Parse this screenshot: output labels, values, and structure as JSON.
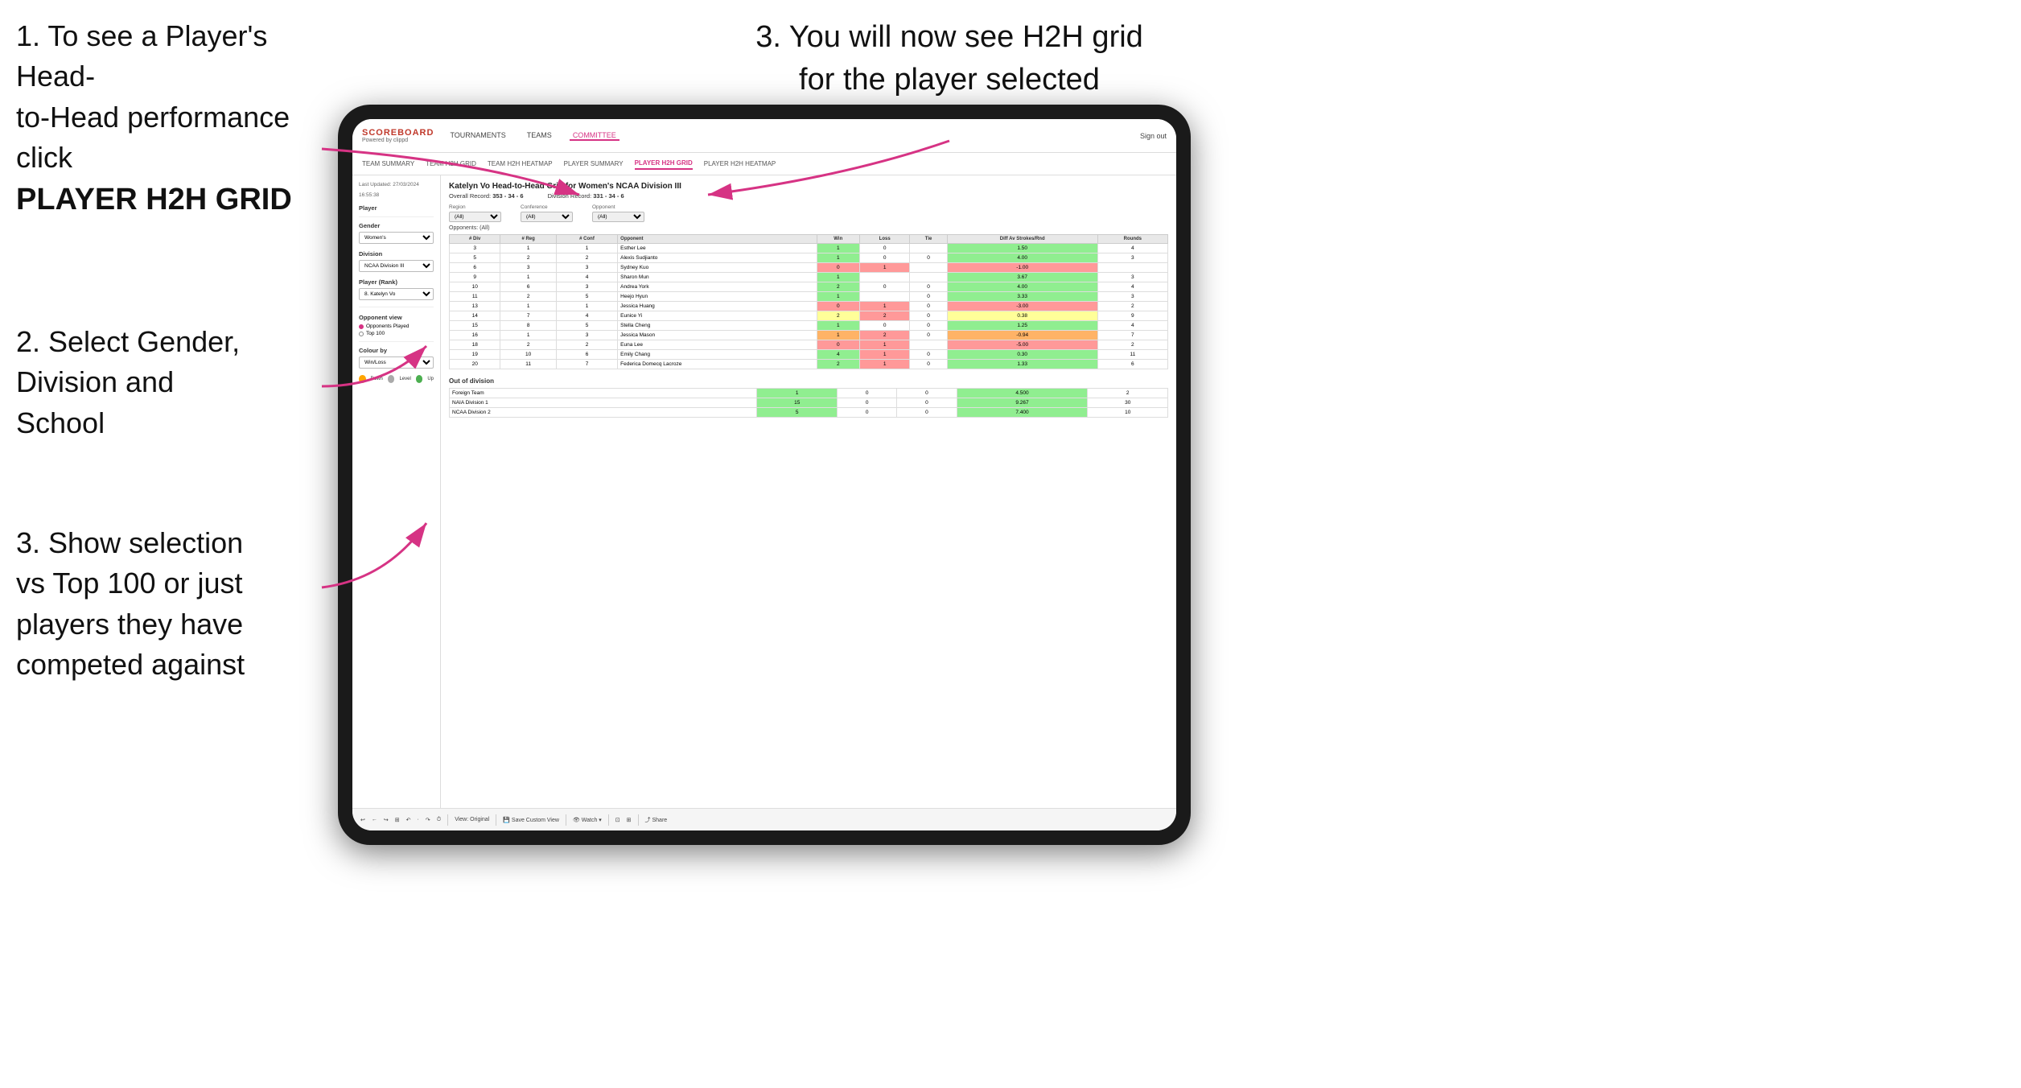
{
  "instructions": {
    "instr1_line1": "1. To see a Player's Head-",
    "instr1_line2": "to-Head performance click",
    "instr1_bold": "PLAYER H2H GRID",
    "instr2_line1": "2. Select Gender,",
    "instr2_line2": "Division and",
    "instr2_line3": "School",
    "instr3_top_line1": "3. You will now see H2H grid",
    "instr3_top_line2": "for the player selected",
    "instr3_bottom_line1": "3. Show selection",
    "instr3_bottom_line2": "vs Top 100 or just",
    "instr3_bottom_line3": "players they have",
    "instr3_bottom_line4": "competed against"
  },
  "nav": {
    "logo": "SCOREBOARD",
    "logo_sub": "Powered by clippd",
    "links": [
      "TOURNAMENTS",
      "TEAMS",
      "COMMITTEE"
    ],
    "active_link": "COMMITTEE",
    "sign_out": "Sign out"
  },
  "sub_nav": {
    "links": [
      "TEAM SUMMARY",
      "TEAM H2H GRID",
      "TEAM H2H HEATMAP",
      "PLAYER SUMMARY",
      "PLAYER H2H GRID",
      "PLAYER H2H HEATMAP"
    ],
    "active": "PLAYER H2H GRID"
  },
  "sidebar": {
    "last_updated": "Last Updated: 27/03/2024",
    "time": "16:55:38",
    "player_label": "Player",
    "gender_label": "Gender",
    "gender_value": "Women's",
    "division_label": "Division",
    "division_value": "NCAA Division III",
    "player_rank_label": "Player (Rank)",
    "player_rank_value": "8. Katelyn Vo",
    "opponent_view_label": "Opponent view",
    "radio1": "Opponents Played",
    "radio2": "Top 100",
    "colour_by_label": "Colour by",
    "colour_value": "Win/Loss",
    "legend_down": "Down",
    "legend_level": "Level",
    "legend_up": "Up"
  },
  "panel": {
    "title": "Katelyn Vo Head-to-Head Grid for Women's NCAA Division III",
    "overall_record_label": "Overall Record:",
    "overall_record": "353 - 34 - 6",
    "division_record_label": "Division Record:",
    "division_record": "331 - 34 - 6",
    "region_label": "Region",
    "conference_label": "Conference",
    "opponent_label": "Opponent",
    "opponents_label": "Opponents:",
    "filter_all": "(All)",
    "columns": [
      "# Div",
      "# Reg",
      "# Conf",
      "Opponent",
      "Win",
      "Loss",
      "Tie",
      "Diff Av Strokes/Rnd",
      "Rounds"
    ],
    "rows": [
      {
        "div": "3",
        "reg": "1",
        "conf": "1",
        "opponent": "Esther Lee",
        "win": "1",
        "loss": "0",
        "tie": "",
        "diff": "1.50",
        "rounds": "4",
        "win_color": "green"
      },
      {
        "div": "5",
        "reg": "2",
        "conf": "2",
        "opponent": "Alexis Sudjianto",
        "win": "1",
        "loss": "0",
        "tie": "0",
        "diff": "4.00",
        "rounds": "3",
        "win_color": "green"
      },
      {
        "div": "6",
        "reg": "3",
        "conf": "3",
        "opponent": "Sydney Kuo",
        "win": "0",
        "loss": "1",
        "tie": "",
        "diff": "-1.00",
        "rounds": "",
        "win_color": "red"
      },
      {
        "div": "9",
        "reg": "1",
        "conf": "4",
        "opponent": "Sharon Mun",
        "win": "1",
        "loss": "",
        "tie": "",
        "diff": "3.67",
        "rounds": "3",
        "win_color": "green"
      },
      {
        "div": "10",
        "reg": "6",
        "conf": "3",
        "opponent": "Andrea York",
        "win": "2",
        "loss": "0",
        "tie": "0",
        "diff": "4.00",
        "rounds": "4",
        "win_color": "green"
      },
      {
        "div": "11",
        "reg": "2",
        "conf": "5",
        "opponent": "Heejo Hyun",
        "win": "1",
        "loss": "",
        "tie": "0",
        "diff": "3.33",
        "rounds": "3",
        "win_color": "green"
      },
      {
        "div": "13",
        "reg": "1",
        "conf": "1",
        "opponent": "Jessica Huang",
        "win": "0",
        "loss": "1",
        "tie": "0",
        "diff": "-3.00",
        "rounds": "2",
        "win_color": "red"
      },
      {
        "div": "14",
        "reg": "7",
        "conf": "4",
        "opponent": "Eunice Yi",
        "win": "2",
        "loss": "2",
        "tie": "0",
        "diff": "0.38",
        "rounds": "9",
        "win_color": "yellow"
      },
      {
        "div": "15",
        "reg": "8",
        "conf": "5",
        "opponent": "Stella Cheng",
        "win": "1",
        "loss": "0",
        "tie": "0",
        "diff": "1.25",
        "rounds": "4",
        "win_color": "green"
      },
      {
        "div": "16",
        "reg": "1",
        "conf": "3",
        "opponent": "Jessica Mason",
        "win": "1",
        "loss": "2",
        "tie": "0",
        "diff": "-0.94",
        "rounds": "7",
        "win_color": "orange"
      },
      {
        "div": "18",
        "reg": "2",
        "conf": "2",
        "opponent": "Euna Lee",
        "win": "0",
        "loss": "1",
        "tie": "",
        "diff": "-5.00",
        "rounds": "2",
        "win_color": "red"
      },
      {
        "div": "19",
        "reg": "10",
        "conf": "6",
        "opponent": "Emily Chang",
        "win": "4",
        "loss": "1",
        "tie": "0",
        "diff": "0.30",
        "rounds": "11",
        "win_color": "green"
      },
      {
        "div": "20",
        "reg": "11",
        "conf": "7",
        "opponent": "Federica Domecq Lacroze",
        "win": "2",
        "loss": "1",
        "tie": "0",
        "diff": "1.33",
        "rounds": "6",
        "win_color": "green"
      }
    ],
    "out_of_division_label": "Out of division",
    "out_rows": [
      {
        "name": "Foreign Team",
        "win": "1",
        "loss": "0",
        "tie": "0",
        "diff": "4.500",
        "rounds": "2",
        "win_color": "green"
      },
      {
        "name": "NAIA Division 1",
        "win": "15",
        "loss": "0",
        "tie": "0",
        "diff": "9.267",
        "rounds": "30",
        "win_color": "green"
      },
      {
        "name": "NCAA Division 2",
        "win": "5",
        "loss": "0",
        "tie": "0",
        "diff": "7.400",
        "rounds": "10",
        "win_color": "green"
      }
    ]
  },
  "toolbar": {
    "buttons": [
      "↩",
      "←",
      "↪",
      "⊞",
      "↶",
      "·",
      "↷",
      "⏱",
      "View: Original",
      "Save Custom View",
      "👁 Watch ▾",
      "⊡",
      "⊞",
      "Share"
    ]
  }
}
